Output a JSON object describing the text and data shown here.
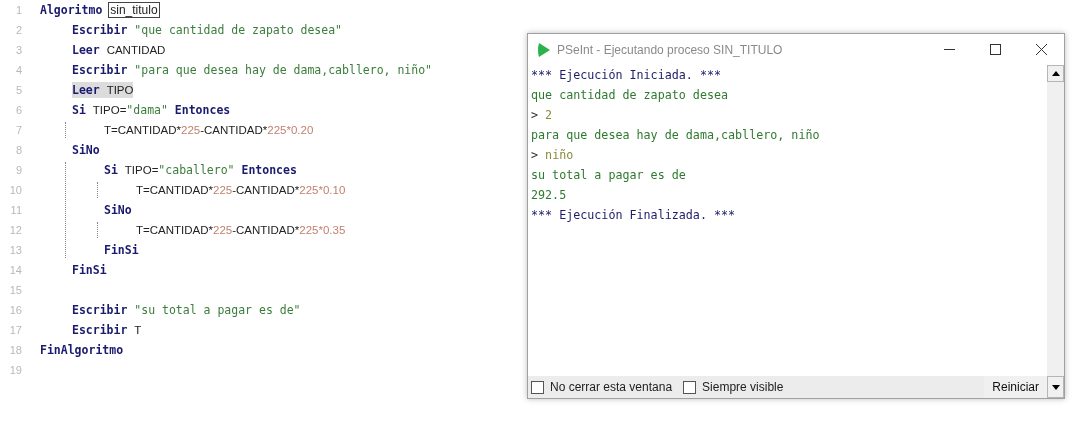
{
  "editor": {
    "lines": [
      {
        "number": "1",
        "selected": false,
        "tokens": [
          {
            "kind": "keyword",
            "text": "Algoritmo"
          },
          {
            "kind": "name",
            "text": "sin_titulo"
          }
        ],
        "children": [
          {
            "number": "2",
            "selected": false,
            "tokens": [
              {
                "kind": "keyword",
                "text": "Escribir"
              },
              {
                "kind": "string",
                "text": "\"que cantidad de zapato desea\""
              }
            ]
          },
          {
            "number": "3",
            "selected": false,
            "tokens": [
              {
                "kind": "keyword",
                "text": "Leer"
              },
              {
                "kind": "ident",
                "text": "CANTIDAD"
              }
            ]
          },
          {
            "number": "4",
            "selected": false,
            "tokens": [
              {
                "kind": "keyword",
                "text": "Escribir"
              },
              {
                "kind": "string",
                "text": "\"para que desea hay de dama,cabllero, niño\""
              }
            ]
          },
          {
            "number": "5",
            "selected": true,
            "tokens": [
              {
                "kind": "keyword",
                "text": "Leer"
              },
              {
                "kind": "ident",
                "text": "TIPO"
              }
            ]
          },
          {
            "number": "6",
            "selected": false,
            "tokens": [
              {
                "kind": "keyword",
                "text": "Si"
              },
              {
                "kind": "ident",
                "text": "TIPO="
              },
              {
                "kind": "string",
                "text": "\"dama\""
              },
              {
                "kind": "keyword",
                "text": "Entonces"
              }
            ],
            "children": [
              {
                "number": "7",
                "selected": false,
                "tokens": [
                  {
                    "kind": "ident",
                    "text": "T=CANTIDAD*"
                  },
                  {
                    "kind": "number",
                    "text": "225"
                  },
                  {
                    "kind": "ident",
                    "text": "-CANTIDAD*"
                  },
                  {
                    "kind": "number",
                    "text": "225*0.20"
                  }
                ]
              }
            ]
          },
          {
            "number": "8",
            "selected": false,
            "tokens": [
              {
                "kind": "keyword",
                "text": "SiNo"
              }
            ],
            "children": [
              {
                "number": "9",
                "selected": false,
                "tokens": [
                  {
                    "kind": "keyword",
                    "text": "Si"
                  },
                  {
                    "kind": "ident",
                    "text": "TIPO="
                  },
                  {
                    "kind": "string",
                    "text": "\"caballero\""
                  },
                  {
                    "kind": "keyword",
                    "text": "Entonces"
                  }
                ],
                "children": [
                  {
                    "number": "10",
                    "selected": false,
                    "tokens": [
                      {
                        "kind": "ident",
                        "text": "T=CANTIDAD*"
                      },
                      {
                        "kind": "number",
                        "text": "225"
                      },
                      {
                        "kind": "ident",
                        "text": "-CANTIDAD*"
                      },
                      {
                        "kind": "number",
                        "text": "225*0.10"
                      }
                    ]
                  }
                ]
              },
              {
                "number": "11",
                "selected": false,
                "tokens": [
                  {
                    "kind": "keyword",
                    "text": "SiNo"
                  }
                ],
                "children": [
                  {
                    "number": "12",
                    "selected": false,
                    "tokens": [
                      {
                        "kind": "ident",
                        "text": "T=CANTIDAD*"
                      },
                      {
                        "kind": "number",
                        "text": "225"
                      },
                      {
                        "kind": "ident",
                        "text": "-CANTIDAD*"
                      },
                      {
                        "kind": "number",
                        "text": "225*0.35"
                      }
                    ]
                  }
                ]
              },
              {
                "number": "13",
                "selected": false,
                "tokens": [
                  {
                    "kind": "keyword",
                    "text": "FinSi"
                  }
                ]
              }
            ]
          },
          {
            "number": "14",
            "selected": false,
            "tokens": [
              {
                "kind": "keyword",
                "text": "FinSi"
              }
            ]
          },
          {
            "number": "15",
            "selected": false
          },
          {
            "number": "16",
            "selected": false,
            "tokens": [
              {
                "kind": "keyword",
                "text": "Escribir"
              },
              {
                "kind": "string",
                "text": "\"su total a pagar es de\""
              }
            ]
          },
          {
            "number": "17",
            "selected": false,
            "tokens": [
              {
                "kind": "keyword",
                "text": "Escribir"
              },
              {
                "kind": "ident",
                "text": "T"
              }
            ]
          }
        ]
      },
      {
        "number": "18",
        "selected": false,
        "tokens": [
          {
            "kind": "keyword",
            "text": "FinAlgoritmo"
          }
        ]
      },
      {
        "number": "19",
        "selected": false
      }
    ]
  },
  "run_window": {
    "title": "PSeInt - Ejecutando proceso SIN_TITULO",
    "console": [
      {
        "kind": "system",
        "text": "*** Ejecución Iniciada. ***"
      },
      {
        "kind": "output",
        "text": "que cantidad de zapato desea"
      },
      {
        "kind": "input",
        "prompt": ">",
        "text": "2"
      },
      {
        "kind": "output",
        "text": "para que desea hay de dama,cabllero, niño"
      },
      {
        "kind": "input",
        "prompt": ">",
        "text": "niño"
      },
      {
        "kind": "output",
        "text": "su total a pagar es de"
      },
      {
        "kind": "output",
        "text": "292.5"
      },
      {
        "kind": "system",
        "text": "*** Ejecución Finalizada. ***"
      }
    ],
    "options": [
      {
        "label": "No cerrar esta ventana",
        "checked": false
      },
      {
        "label": "Siempre visible",
        "checked": false
      }
    ],
    "restart_button": "Reiniciar"
  }
}
